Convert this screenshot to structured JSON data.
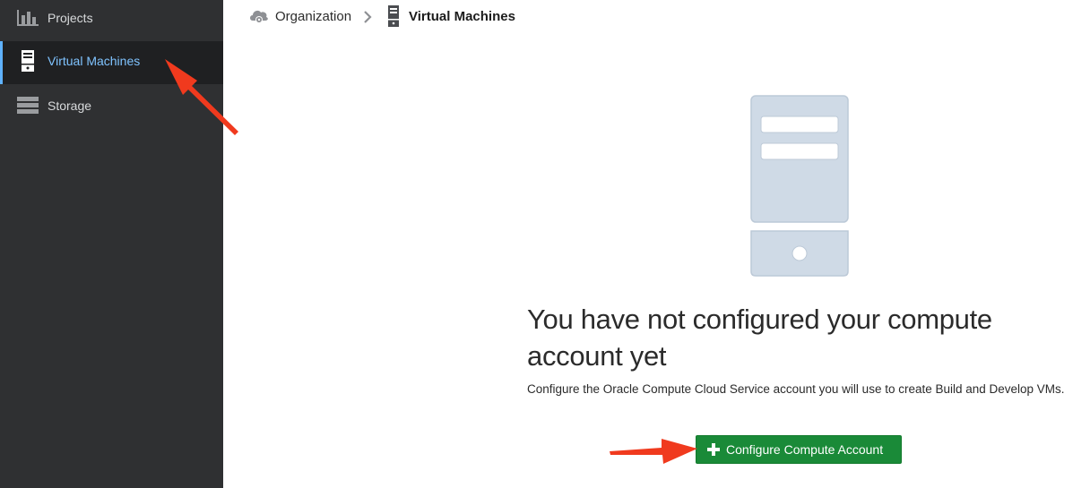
{
  "sidebar": {
    "items": [
      {
        "label": "Projects",
        "icon": "bar-chart-icon",
        "active": false
      },
      {
        "label": "Virtual Machines",
        "icon": "server-icon",
        "active": true
      },
      {
        "label": "Storage",
        "icon": "storage-icon",
        "active": false
      }
    ]
  },
  "breadcrumb": {
    "organization": "Organization",
    "current": "Virtual Machines"
  },
  "empty_state": {
    "title": "You have not configured your compute account yet",
    "description": "Configure the Oracle Compute Cloud Service account you will use to create Build and Develop VMs.",
    "button_label": "Configure Compute Account"
  },
  "colors": {
    "sidebar_bg": "#2f3032",
    "active_label": "#7fc3ff",
    "button_green": "#1a8a38",
    "illustration": "#cfdae6",
    "annotation_arrow": "#f03a1e"
  }
}
